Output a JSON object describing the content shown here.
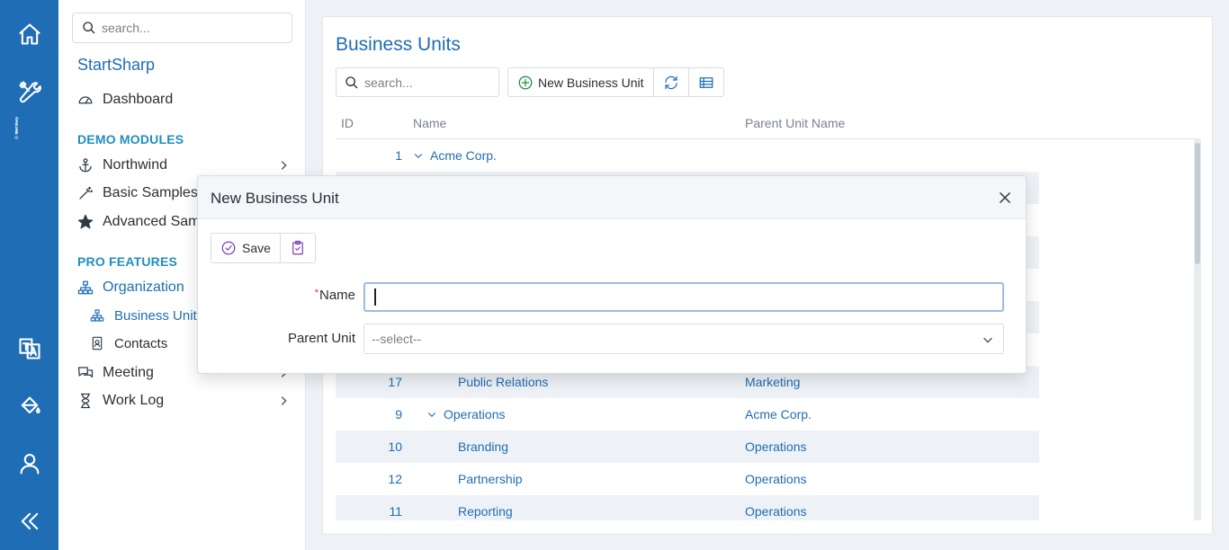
{
  "rail": {
    "brand": "StartSharp",
    "icons": [
      "home-icon",
      "tools-icon",
      "translate-icon",
      "paint-bucket-icon",
      "user-icon",
      "collapse-icon"
    ]
  },
  "nav": {
    "search_placeholder": "search...",
    "title": "StartSharp",
    "dashboard": "Dashboard",
    "section_demo": "DEMO MODULES",
    "northwind": "Northwind",
    "basic_samples": "Basic Samples",
    "advanced_samples": "Advanced Samples",
    "section_pro": "PRO FEATURES",
    "organization": "Organization",
    "business_units": "Business Units",
    "contacts": "Contacts",
    "meeting": "Meeting",
    "work_log": "Work Log"
  },
  "page": {
    "title": "Business Units",
    "search_placeholder": "search...",
    "new_button": "New Business Unit",
    "columns": {
      "id": "ID",
      "name": "Name",
      "parent": "Parent Unit Name"
    },
    "rows": [
      {
        "id": "1",
        "name": "Acme Corp.",
        "parent": "",
        "expanded": true,
        "level": 0
      },
      {
        "id": "",
        "name": "",
        "parent": "",
        "level": 1
      },
      {
        "id": "",
        "name": "",
        "parent": "",
        "level": 1
      },
      {
        "id": "",
        "name": "",
        "parent": "",
        "level": 1
      },
      {
        "id": "",
        "name": "",
        "parent": "",
        "level": 1
      },
      {
        "id": "",
        "name": "",
        "parent": "",
        "level": 1
      },
      {
        "id": "",
        "name": "",
        "parent": "",
        "level": 1
      },
      {
        "id": "17",
        "name": "Public Relations",
        "parent": "Marketing",
        "level": 2
      },
      {
        "id": "9",
        "name": "Operations",
        "parent": "Acme Corp.",
        "expanded": true,
        "level": 1
      },
      {
        "id": "10",
        "name": "Branding",
        "parent": "Operations",
        "level": 2
      },
      {
        "id": "12",
        "name": "Partnership",
        "parent": "Operations",
        "level": 2
      },
      {
        "id": "11",
        "name": "Reporting",
        "parent": "Operations",
        "level": 2
      }
    ]
  },
  "dialog": {
    "title": "New Business Unit",
    "save": "Save",
    "required_mark": "*",
    "name_label": "Name",
    "name_value": "",
    "parent_label": "Parent Unit",
    "parent_value": "--select--"
  },
  "colors": {
    "accent": "#1f6db4",
    "section": "#1f8fc0",
    "rail": "#1f6db4",
    "required": "#d33333",
    "dialog_icon": "#7a3fb3"
  }
}
